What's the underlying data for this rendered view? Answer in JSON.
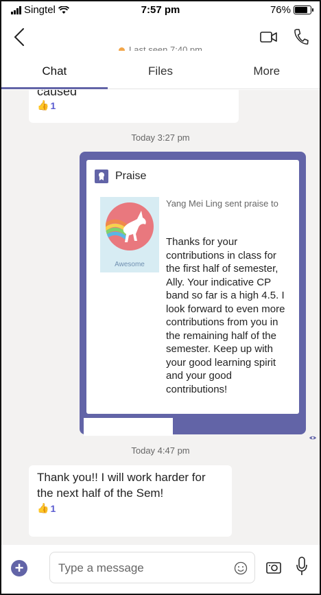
{
  "status_bar": {
    "carrier": "Singtel",
    "time": "7:57 pm",
    "battery": "76%"
  },
  "header": {
    "subtitle": "Last seen 7:40 pm"
  },
  "tabs": [
    {
      "label": "Chat"
    },
    {
      "label": "Files"
    },
    {
      "label": "More"
    }
  ],
  "messages": {
    "first": {
      "text": "caused",
      "reaction_count": "1"
    },
    "timestamp1": "Today 3:27 pm",
    "praise_card": {
      "title": "Praise",
      "sticker_label": "Awesome",
      "sender_line": "Yang Mei Ling sent praise to",
      "body": "Thanks for your contributions in class for the first half of semester, Ally. Your indicative CP band so far is a high 4.5. I look forward to even more contributions from you in the remaining half of the semester. Keep up with your good learning spirit and your good contributions!"
    },
    "timestamp2": "Today 4:47 pm",
    "reply": {
      "text": "Thank you!! I will work harder for the next half of the Sem!",
      "reaction_count": "1"
    }
  },
  "compose": {
    "placeholder": "Type a message"
  },
  "colors": {
    "accent": "#6264a7",
    "chat_bg": "#f3f2f1",
    "reaction": "#5a5bd0"
  }
}
